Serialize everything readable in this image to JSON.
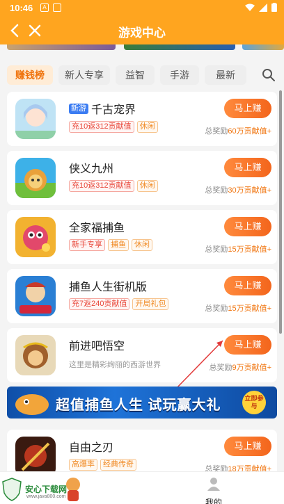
{
  "status_bar": {
    "time": "10:46"
  },
  "app_bar": {
    "title": "游戏中心"
  },
  "tabs": [
    {
      "label": "赚钱榜",
      "active": true
    },
    {
      "label": "新人专享",
      "active": false
    },
    {
      "label": "益智",
      "active": false
    },
    {
      "label": "手游",
      "active": false
    },
    {
      "label": "最新",
      "active": false
    }
  ],
  "games": [
    {
      "name": "千古宠界",
      "badge": "新游",
      "tags": [
        {
          "text": "充10返312贡献值",
          "style": "red"
        },
        {
          "text": "休闲",
          "style": "orange"
        }
      ],
      "desc": "",
      "button": "马上赚",
      "reward_prefix": "总奖励",
      "reward_amount": "60万贡献值+",
      "icon": "pet-girl-icon"
    },
    {
      "name": "侠义九州",
      "badge": "",
      "tags": [
        {
          "text": "充10返312贡献值",
          "style": "red"
        },
        {
          "text": "休闲",
          "style": "orange"
        }
      ],
      "desc": "",
      "button": "马上赚",
      "reward_prefix": "总奖励",
      "reward_amount": "30万贡献值+",
      "icon": "lion-hero-icon"
    },
    {
      "name": "全家福捕鱼",
      "badge": "",
      "tags": [
        {
          "text": "新手专享",
          "style": "red"
        },
        {
          "text": "捕鱼",
          "style": "orange"
        },
        {
          "text": "休闲",
          "style": "orange"
        }
      ],
      "desc": "",
      "button": "马上赚",
      "reward_prefix": "总奖励",
      "reward_amount": "15万贡献值+",
      "icon": "pink-fish-icon"
    },
    {
      "name": "捕鱼人生街机版",
      "badge": "",
      "tags": [
        {
          "text": "充7返240贡献值",
          "style": "red"
        },
        {
          "text": "开局礼包",
          "style": "orange"
        }
      ],
      "desc": "",
      "button": "马上赚",
      "reward_prefix": "总奖励",
      "reward_amount": "15万贡献值+",
      "icon": "arcade-fishing-icon"
    },
    {
      "name": "前进吧悟空",
      "badge": "",
      "tags": [],
      "desc": "这里是精彩绚丽的西游世界",
      "button": "马上赚",
      "reward_prefix": "总奖励",
      "reward_amount": "9万贡献值+",
      "icon": "monkey-king-icon"
    },
    {
      "name": "自由之刃",
      "badge": "",
      "tags": [
        {
          "text": "高爆率",
          "style": "orange"
        },
        {
          "text": "经典传奇",
          "style": "orange"
        }
      ],
      "desc": "",
      "button": "马上赚",
      "reward_prefix": "总奖励",
      "reward_amount": "18万贡献值+",
      "icon": "blade-warrior-icon"
    }
  ],
  "banner": {
    "text": "超值捕鱼人生 试玩赢大礼",
    "button": "立即参与"
  },
  "bottom_nav": {
    "brand": "安心下载网",
    "url": "www.java800.com",
    "mine_label": "我的"
  },
  "colors": {
    "primary": "#ffa51f",
    "accent": "#f3651c",
    "tag_red": "#e8473a",
    "tag_orange": "#f08a24"
  }
}
